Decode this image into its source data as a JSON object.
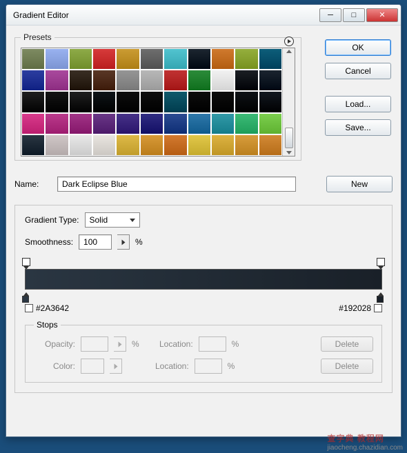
{
  "window": {
    "title": "Gradient Editor"
  },
  "buttons": {
    "ok": "OK",
    "cancel": "Cancel",
    "load": "Load...",
    "save": "Save...",
    "new": "New",
    "delete": "Delete"
  },
  "presets": {
    "legend": "Presets",
    "swatches": [
      [
        "#7e8b62",
        "#99b2f0",
        "#8eab48",
        "#d73b3b",
        "#cb9c33",
        "#6e6e6e",
        "#52c4d0",
        "#1c2630",
        "#d07a2e",
        "#95af3d",
        "#0d5e7a"
      ],
      [
        "#2d3ea0",
        "#aa4a9e",
        "#3a2f25",
        "#5a3827",
        "#969696",
        "#b8b8b8",
        "#c13333",
        "#2c8c3a",
        "#f2f2f2",
        "#1b1f24",
        "#1b2530"
      ],
      [
        "#202020",
        "#141414",
        "#202020",
        "#0e1418",
        "#0d0d0d",
        "#0d0d0d",
        "#0f5a6c",
        "#0d0d0d",
        "#0d0d0d",
        "#0e1216",
        "#121820"
      ],
      [
        "#d93b8c",
        "#bb3a8c",
        "#a23487",
        "#6a3787",
        "#473288",
        "#302c82",
        "#2b4b92",
        "#2e78aa",
        "#329aa8",
        "#3cbb77",
        "#7ccf4e"
      ],
      [
        "#2a3642",
        "#d0c7c7",
        "#e8e8e8",
        "#e9e5e0",
        "#deba48",
        "#d89a38",
        "#d37a30",
        "#e2c84a",
        "#ddb342",
        "#d89d3c",
        "#d38a36"
      ]
    ]
  },
  "name": {
    "label": "Name:",
    "value": "Dark Eclipse Blue"
  },
  "gradient": {
    "type_label": "Gradient Type:",
    "type_value": "Solid",
    "smooth_label": "Smoothness:",
    "smooth_value": "100",
    "percent": "%",
    "left_hex": "#2A3642",
    "right_hex": "#192028"
  },
  "stops": {
    "legend": "Stops",
    "opacity_label": "Opacity:",
    "color_label": "Color:",
    "location_label": "Location:"
  },
  "watermark": {
    "main": "查字典 教程网",
    "sub": "jiaocheng.chazidian.com"
  }
}
